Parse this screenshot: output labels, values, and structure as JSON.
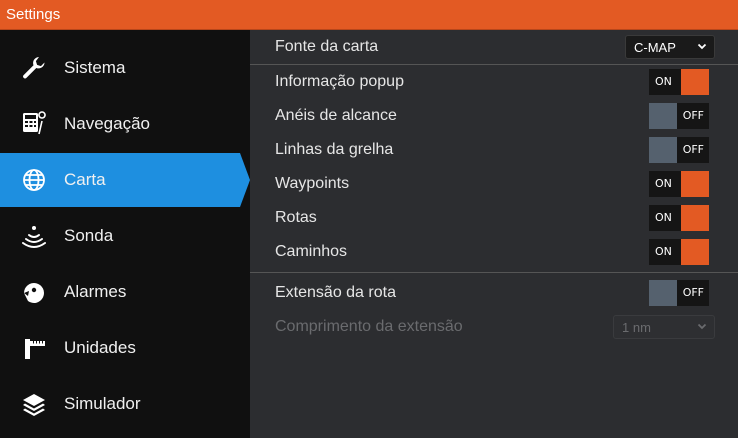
{
  "window": {
    "title": "Settings",
    "accent_color": "#e35a23"
  },
  "sidebar": {
    "items": [
      {
        "label": "Sistema",
        "icon": "wrench-icon",
        "active": false
      },
      {
        "label": "Navegação",
        "icon": "navigation-calculator-icon",
        "active": false
      },
      {
        "label": "Carta",
        "icon": "globe-icon",
        "active": true
      },
      {
        "label": "Sonda",
        "icon": "sonar-icon",
        "active": false
      },
      {
        "label": "Alarmes",
        "icon": "alarm-icon",
        "active": false
      },
      {
        "label": "Unidades",
        "icon": "units-ruler-icon",
        "active": false
      },
      {
        "label": "Simulador",
        "icon": "layers-icon",
        "active": false
      }
    ],
    "active_color": "#1e8fe0"
  },
  "settings": {
    "rows": [
      {
        "label": "Fonte da carta",
        "control": "select",
        "value": "C-MAP",
        "enabled": true
      },
      {
        "label": "Informação popup",
        "control": "toggle",
        "value": "ON",
        "enabled": true
      },
      {
        "label": "Anéis de alcance",
        "control": "toggle",
        "value": "OFF",
        "enabled": true
      },
      {
        "label": "Linhas da grelha",
        "control": "toggle",
        "value": "OFF",
        "enabled": true
      },
      {
        "label": "Waypoints",
        "control": "toggle",
        "value": "ON",
        "enabled": true
      },
      {
        "label": "Rotas",
        "control": "toggle",
        "value": "ON",
        "enabled": true
      },
      {
        "label": "Caminhos",
        "control": "toggle",
        "value": "ON",
        "enabled": true
      },
      {
        "label": "Extensão da rota",
        "control": "toggle",
        "value": "OFF",
        "enabled": true
      },
      {
        "label": "Comprimento da extensão",
        "control": "select",
        "value": "1 nm",
        "enabled": false
      }
    ]
  }
}
